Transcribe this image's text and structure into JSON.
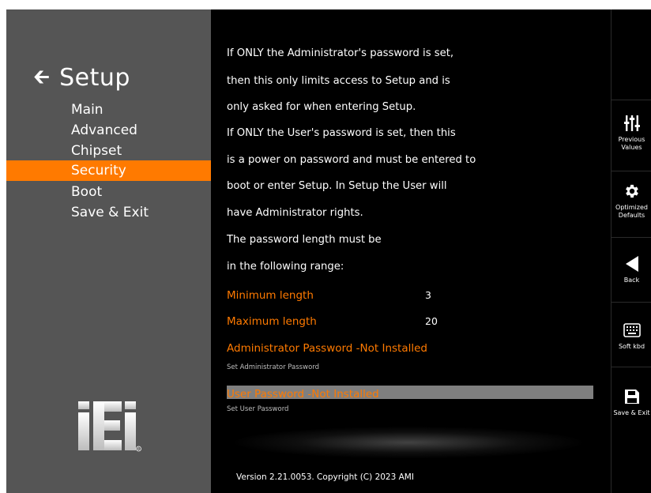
{
  "sidebar": {
    "title": "Setup",
    "items": [
      {
        "label": "Main"
      },
      {
        "label": "Advanced"
      },
      {
        "label": "Chipset"
      },
      {
        "label": "Security",
        "active": true
      },
      {
        "label": "Boot"
      },
      {
        "label": "Save & Exit"
      }
    ]
  },
  "help": {
    "lines": [
      "If ONLY the Administrator's password is set,",
      "then this only limits access to Setup and is",
      "only asked for when entering Setup.",
      "If ONLY the User's password is set, then this",
      "is a power on password and must be entered to",
      "boot or enter Setup. In Setup the User will",
      "have Administrator rights.",
      "The password length must be",
      "in the following range:"
    ]
  },
  "options": {
    "min_length": {
      "label": "Minimum length",
      "value": "3"
    },
    "max_length": {
      "label": "Maximum length",
      "value": "20"
    },
    "admin_password": {
      "label": "Administrator Password -Not Installed",
      "description": "Set Administrator Password"
    },
    "user_password": {
      "label": "User Password -Not Installed",
      "description": "Set User Password"
    }
  },
  "footer": {
    "copyright": "Version 2.21.0053. Copyright (C) 2023 AMI"
  },
  "toolbar": {
    "previous_values": "Previous Values",
    "optimized_defaults": "Optimized Defaults",
    "back": "Back",
    "soft_kbd": "Soft kbd",
    "save_exit": "Save & Exit"
  },
  "colors": {
    "accent": "#ff7a00",
    "sidebar_bg": "#555555",
    "content_bg": "#000000",
    "highlight_row": "#7f7f7f"
  }
}
